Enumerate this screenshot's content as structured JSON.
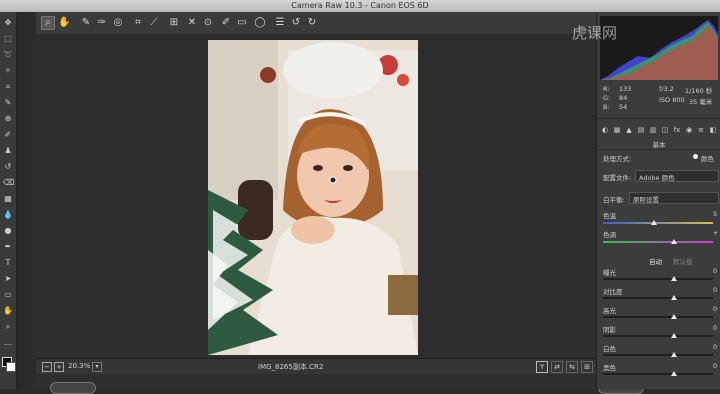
{
  "window": {
    "title": "Camera Raw 10.3 - Canon EOS 6D"
  },
  "watermark": {
    "text": "虎课网"
  },
  "file": {
    "name": "IMG_8265副本.CR2",
    "zoom": "20.3%"
  },
  "histogram": {
    "r_label": "R:",
    "r_value": "133",
    "g_label": "G:",
    "g_value": "84",
    "b_label": "B:",
    "b_value": "54",
    "aperture": "f/3.2",
    "shutter": "1/160 秒",
    "iso": "ISO 800",
    "focal": "35 毫米"
  },
  "panel": {
    "title": "基本",
    "treatment_label": "处理方式:",
    "treatment_value": "颜色",
    "profile_label": "配置文件:",
    "profile_value": "Adobe 颜色",
    "wb_label": "白平衡:",
    "wb_value": "原照设置",
    "temp_label": "色温",
    "temp_value": "5",
    "tint_label": "色调",
    "tint_value": "+",
    "auto_label": "自动",
    "default_label": "默认值",
    "sliders": [
      {
        "label": "曝光",
        "value": "0"
      },
      {
        "label": "对比度",
        "value": "0"
      },
      {
        "label": "高光",
        "value": "0"
      },
      {
        "label": "阴影",
        "value": "0"
      },
      {
        "label": "白色",
        "value": "0"
      },
      {
        "label": "黑色",
        "value": "0"
      }
    ]
  },
  "colors": {
    "panel_bg": "#3c3c3c",
    "canvas_bg": "#2d2d2d",
    "accent": "#e6e6e6"
  }
}
